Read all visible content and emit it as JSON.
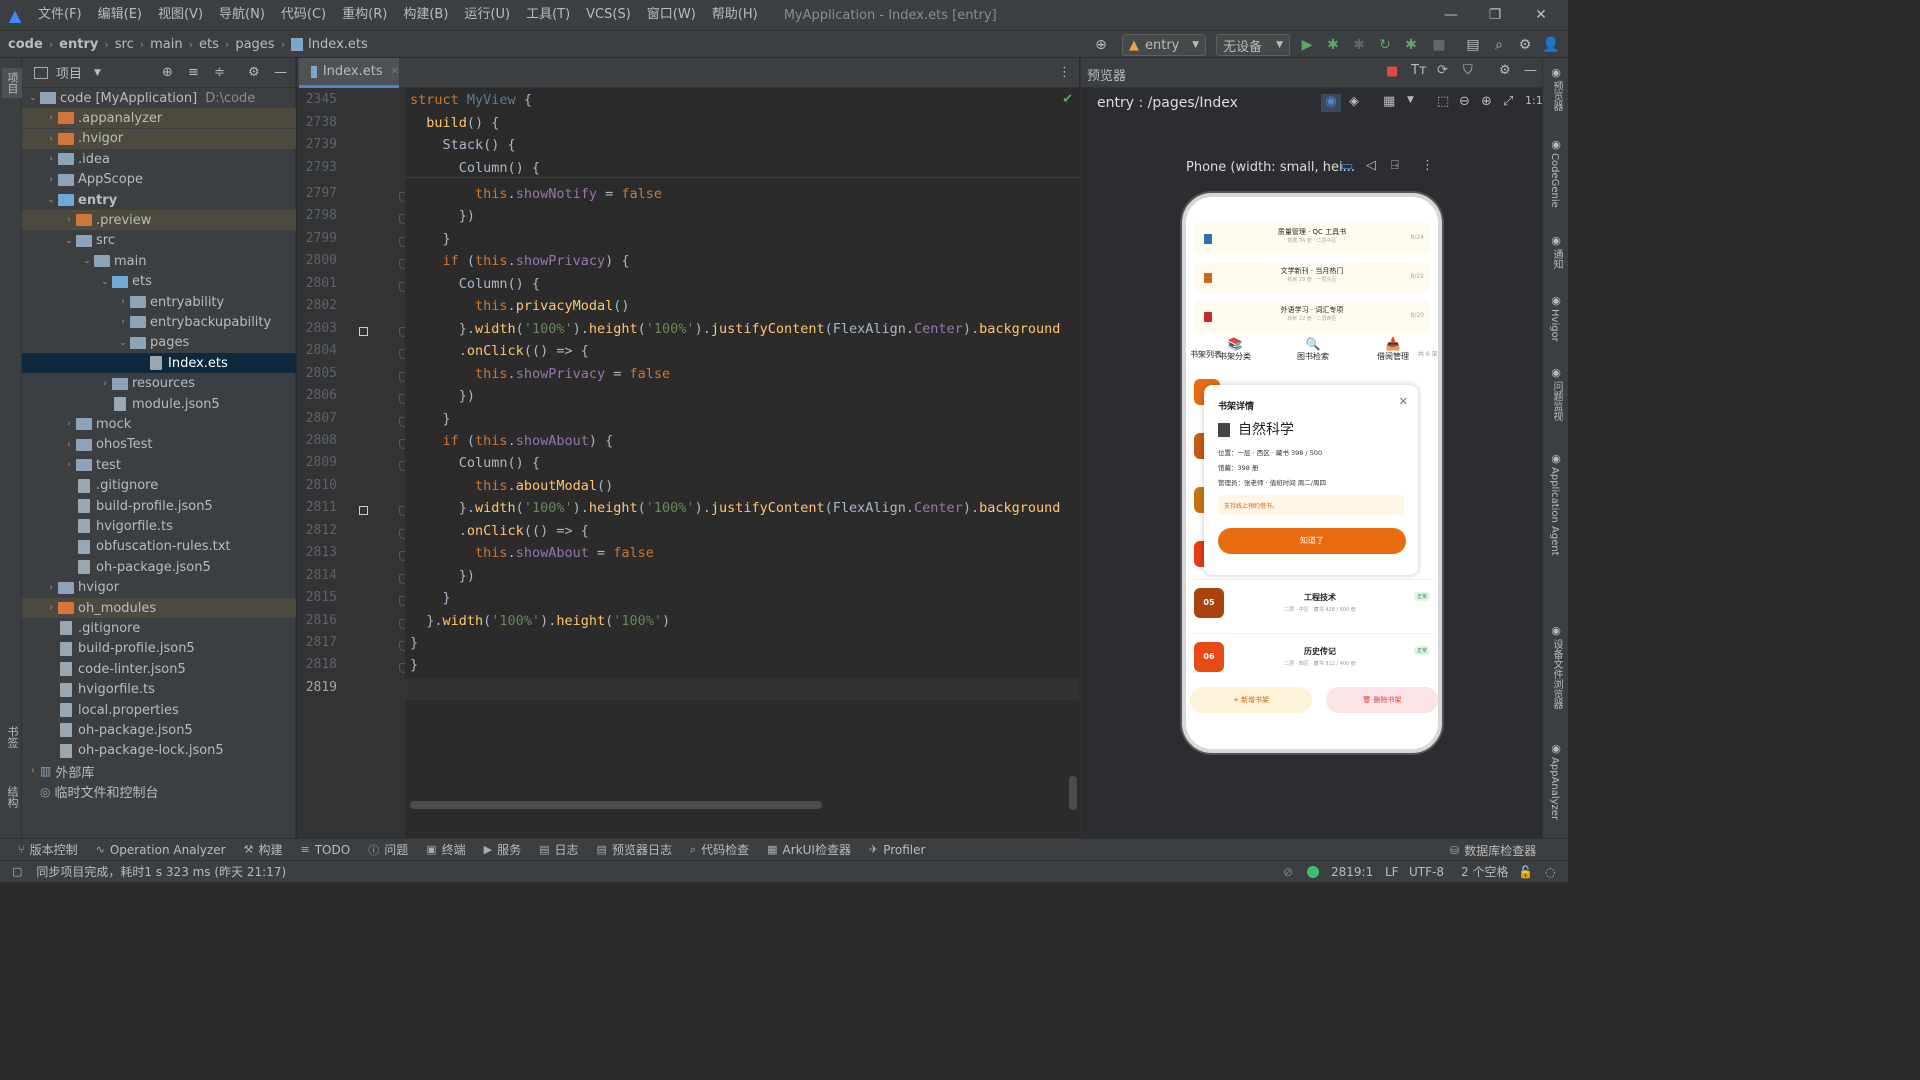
{
  "title_bar": {
    "menus": [
      "文件(F)",
      "编辑(E)",
      "视图(V)",
      "导航(N)",
      "代码(C)",
      "重构(R)",
      "构建(B)",
      "运行(U)",
      "工具(T)",
      "VCS(S)",
      "窗口(W)",
      "帮助(H)"
    ],
    "window_title": "MyApplication - Index.ets [entry]"
  },
  "nav_bar": {
    "breadcrumbs": [
      "code",
      "entry",
      "src",
      "main",
      "ets",
      "pages",
      "Index.ets"
    ],
    "run_config": "entry",
    "device": "无设备"
  },
  "left_stripe": {
    "labels": [
      "项目",
      "书签",
      "结构"
    ]
  },
  "project_panel": {
    "title": "项目",
    "root_name": "code [MyApplication]",
    "root_path": "D:\\code",
    "nodes": [
      {
        "label": ".appanalyzer"
      },
      {
        "label": ".hvigor"
      },
      {
        "label": ".idea"
      },
      {
        "label": "AppScope"
      },
      {
        "label": "entry"
      },
      {
        "label": ".preview"
      },
      {
        "label": "src"
      },
      {
        "label": "main"
      },
      {
        "label": "ets"
      },
      {
        "label": "entryability"
      },
      {
        "label": "entrybackupability"
      },
      {
        "label": "pages"
      },
      {
        "label": "Index.ets"
      },
      {
        "label": "resources"
      },
      {
        "label": "module.json5"
      },
      {
        "label": "mock"
      },
      {
        "label": "ohosTest"
      },
      {
        "label": "test"
      },
      {
        "label": ".gitignore"
      },
      {
        "label": "build-profile.json5"
      },
      {
        "label": "hvigorfile.ts"
      },
      {
        "label": "obfuscation-rules.txt"
      },
      {
        "label": "oh-package.json5"
      },
      {
        "label": "hvigor"
      },
      {
        "label": "oh_modules"
      },
      {
        "label": ".gitignore"
      },
      {
        "label": "build-profile.json5"
      },
      {
        "label": "code-linter.json5"
      },
      {
        "label": "hvigorfile.ts"
      },
      {
        "label": "local.properties"
      },
      {
        "label": "oh-package.json5"
      },
      {
        "label": "oh-package-lock.json5"
      },
      {
        "label": "外部库"
      },
      {
        "label": "临时文件和控制台"
      }
    ]
  },
  "editor": {
    "tab_label": "Index.ets",
    "sticky_lines": [
      "2345",
      "2738",
      "2739",
      "2793"
    ],
    "line_numbers": [
      "2797",
      "2798",
      "2799",
      "2800",
      "2801",
      "2802",
      "2803",
      "2804",
      "2805",
      "2806",
      "2807",
      "2808",
      "2809",
      "2810",
      "2811",
      "2812",
      "2813",
      "2814",
      "2815",
      "2816",
      "2817",
      "2818",
      "2819"
    ],
    "sticky_code": [
      "struct MyView {",
      "  build() {",
      "    Stack() {",
      "      Column() {"
    ],
    "code": [
      "        this.showNotify = false",
      "      })",
      "    }",
      "    if (this.showPrivacy) {",
      "      Column() {",
      "        this.privacyModal()",
      "      }.width('100%').height('100%').justifyContent(FlexAlign.Center).background",
      "      .onClick(() => {",
      "        this.showPrivacy = false",
      "      })",
      "    }",
      "    if (this.showAbout) {",
      "      Column() {",
      "        this.aboutModal()",
      "      }.width('100%').height('100%').justifyContent(FlexAlign.Center).background",
      "      .onClick(() => {",
      "        this.showAbout = false",
      "      })",
      "    }",
      "  }.width('100%').height('100%')",
      "}",
      "}",
      ""
    ]
  },
  "previewer": {
    "panel_title": "预览器",
    "route": "entry : /pages/Index",
    "device_label": "Phone (width: small, hei..."
  },
  "phone": {
    "books": [
      {
        "title": "质量管理 · QC 工具书",
        "sub": "数据 34 册 · 二层中区",
        "date": "8/24"
      },
      {
        "title": "文学新刊 · 当月热门",
        "sub": "新到 28 册 · 一层东区",
        "date": "8/22"
      },
      {
        "title": "外语学习 · 词汇专项",
        "sub": "新到 22 册 · 二层西区",
        "date": "8/20"
      }
    ],
    "quick_actions": [
      "书架分类",
      "图书检索",
      "借阅管理"
    ],
    "shelf_list_label": "书架列表",
    "shelf_count": "共 6 架",
    "modal": {
      "title": "书架详情",
      "name": "自然科学",
      "location": "位置：一层 · 西区 · 藏书 398 / 500",
      "holdings": "馆藏：398 册",
      "manager": "管理员：张老师 · 值班时间 周二/周四",
      "note": "支持线上预约借书。",
      "confirm": "知道了"
    },
    "shelves": [
      {
        "num": "05",
        "name": "工程技术",
        "meta": "二层 · 中区 · 藏书 428 / 500 册",
        "tag": "正常"
      },
      {
        "num": "06",
        "name": "历史传记",
        "meta": "二层 · 西区 · 藏书 312 / 400 册",
        "tag": "正常"
      }
    ],
    "add_button": "+ 新增书架",
    "delete_button": "删除书架"
  },
  "right_stripe": {
    "labels": [
      "预览器",
      "CodeGenie",
      "通知",
      "Hvigor",
      "问题监视",
      "Application Agent",
      "设备文件浏览器",
      "AppAnalyzer"
    ]
  },
  "bottom_tools": [
    "版本控制",
    "Operation Analyzer",
    "构建",
    "TODO",
    "问题",
    "终端",
    "服务",
    "日志",
    "预览器日志",
    "代码检查",
    "ArkUI检查器",
    "Profiler",
    "数据库检查器"
  ],
  "status_bar": {
    "message": "同步项目完成，耗时1 s 323 ms (昨天 21:17)",
    "position": "2819:1",
    "line_sep": "LF",
    "encoding": "UTF-8",
    "indent": "2 个空格"
  },
  "colors": {
    "accent_orange": "#ea6a10",
    "keyword": "#cc7832",
    "function": "#ffc66d",
    "string": "#6a8759",
    "property": "#9876aa"
  }
}
